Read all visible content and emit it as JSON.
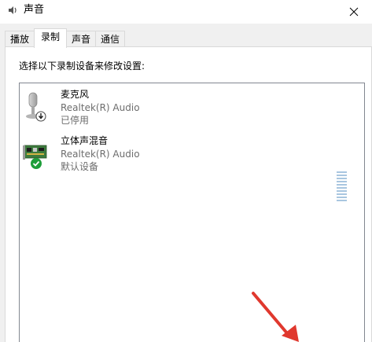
{
  "window": {
    "title": "声音"
  },
  "tabs": [
    {
      "label": "播放",
      "active": false
    },
    {
      "label": "录制",
      "active": true
    },
    {
      "label": "声音",
      "active": false
    },
    {
      "label": "通信",
      "active": false
    }
  ],
  "panel": {
    "instruction": "选择以下录制设备来修改设置:"
  },
  "devices": [
    {
      "name": "麦克风",
      "driver": "Realtek(R) Audio",
      "status": "已停用",
      "icon": "microphone-icon",
      "badge": "disabled-down-arrow-icon"
    },
    {
      "name": "立体声混音",
      "driver": "Realtek(R) Audio",
      "status": "默认设备",
      "icon": "sound-card-icon",
      "badge": "default-check-icon"
    }
  ],
  "colors": {
    "accent_check": "#1e9e3a",
    "arrow": "#e0382e",
    "meter": "#a9c6e0"
  }
}
